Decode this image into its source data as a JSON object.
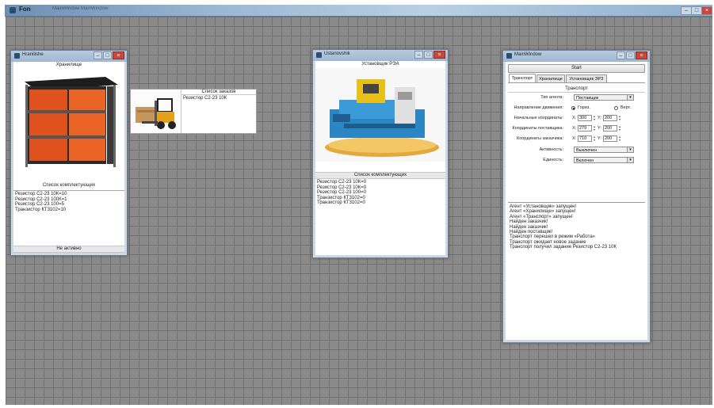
{
  "app": {
    "title": "Fon",
    "menu": "MainWindow   MainWindow"
  },
  "storage_window": {
    "title": "Hranilishe",
    "header": "Хранилище",
    "list_caption": "Список комплектующих",
    "items": [
      "Резистор С2-23 10К=10",
      "Резистор С2-23 100К=1",
      "Резистор С2-23 100=5",
      "Транзистор КТ3102=10"
    ],
    "status": "Не активно"
  },
  "order_panel": {
    "caption": "Список заказов",
    "items": [
      "Резистор С2-23 10К"
    ]
  },
  "installer_window": {
    "title": "Ustanovshik",
    "header": "Установщик РЭА",
    "list_caption": "Список комплектующих",
    "items": [
      "Резистор С2-23 10К=0",
      "Резистор С2-23 10К=0",
      "Резистор С2-23 100=0",
      "Транзистор КТ3102=0",
      "Транзистор КТ3102=0"
    ]
  },
  "main_window": {
    "title": "MainWindow",
    "start_label": "Start",
    "tabs": [
      "Транспорт",
      "Хранилище",
      "Установщик ЭРЗ"
    ],
    "section_title": "Транспорт",
    "agent_type_label": "Тип агента:",
    "agent_type_value": "Поставщик",
    "direction_label": "Направление движения:",
    "direction_horiz": "Гориз.",
    "direction_vert": "Верт.",
    "start_coords_label": "Начальные координаты:",
    "start_x": "300",
    "start_y": "200",
    "supplier_coords_label": "Координаты поставщика:",
    "supplier_x": "279",
    "supplier_y": "200",
    "customer_coords_label": "Координаты заказчика:",
    "customer_x": "710",
    "customer_y": "200",
    "x_label": "X:",
    "y_label": "Y:",
    "activity_label": "Активность:",
    "activity_value": "Выключен",
    "unity_label": "Единость:",
    "unity_value": "Включен",
    "log": [
      "Агент «Установщик» запущен!",
      "Агент «Хранилище» запущен!",
      "Агент «Транспорт» запущен!",
      "Найден заказчик!",
      "Найден заказчик!",
      "Найден поставщик!",
      "Транспорт перешел в режим «Работа»",
      "Транспорт ожидает новое задание",
      "Транспорт получил задание Резистор С2-23 10К"
    ]
  }
}
